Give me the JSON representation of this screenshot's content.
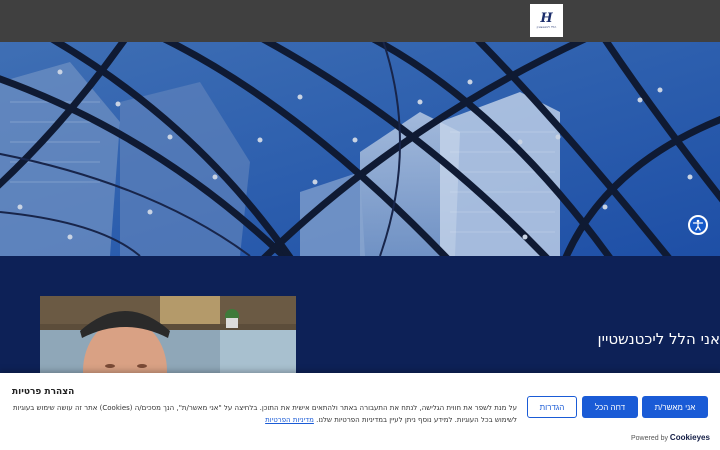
{
  "header": {
    "logo_mark": "H",
    "logo_caption": "הלל ליכטנשטיין"
  },
  "hero": {
    "image": "glass-roof-skyscrapers"
  },
  "accessibility": {
    "icon": "accessibility-icon"
  },
  "main": {
    "name_title": "אני הלל ליכטנשטיין",
    "portrait": "portrait-photo"
  },
  "cookie_banner": {
    "title": "הצהרת פרטיות",
    "text_line1": "על מנת לשפר את חווית הגלישה, לנתח את התעבורה באתר ולהתאים אישית את התוכן. בלחיצה על \"אני מאשר/ת\", הנך מסכים/ה (Cookies) אתר זה עושה שימוש בעוגיות",
    "text_line2": "לשימוש בכל העוגיות. למידע נוסף ניתן לעיין במדיניות הפרטיות שלנו.",
    "policy_link": "מדיניות הפרטיות",
    "buttons": {
      "accept": "אני מאשר/ת",
      "reject": "דחה הכל",
      "settings": "הגדרות"
    },
    "powered_by": "Powered by",
    "powered_brand": "Cookieyes"
  },
  "colors": {
    "topbar": "#404040",
    "navy": "#0d2157",
    "accent": "#1a5bd6"
  }
}
